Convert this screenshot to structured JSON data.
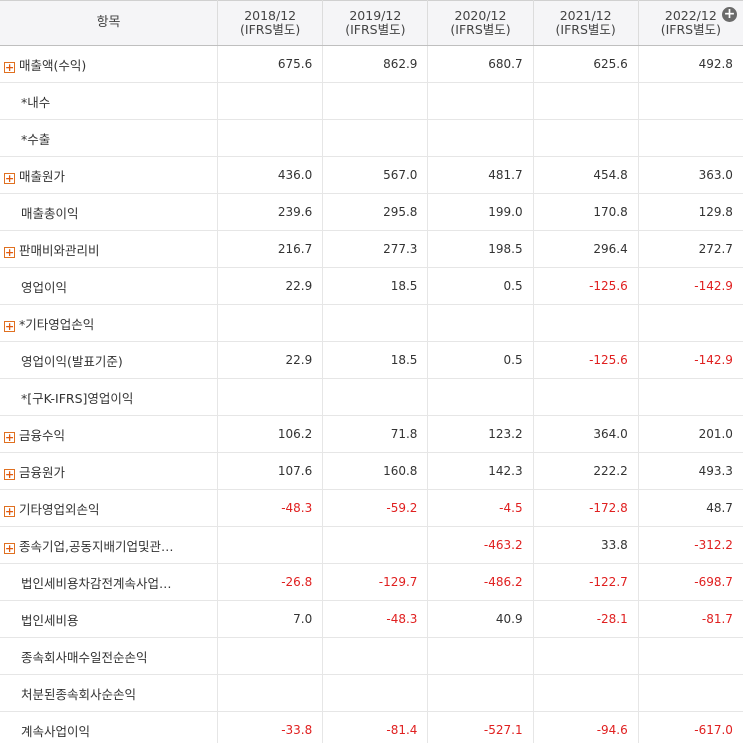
{
  "header": {
    "item_label": "항목",
    "years": [
      {
        "year": "2018/12",
        "basis": "(IFRS별도)"
      },
      {
        "year": "2019/12",
        "basis": "(IFRS별도)"
      },
      {
        "year": "2020/12",
        "basis": "(IFRS별도)"
      },
      {
        "year": "2021/12",
        "basis": "(IFRS별도)"
      },
      {
        "year": "2022/12",
        "basis": "(IFRS별도)"
      }
    ],
    "add_icon": "+"
  },
  "expand_icon": "+",
  "rows": [
    {
      "label": "매출액(수익)",
      "expandable": true,
      "values": [
        "675.6",
        "862.9",
        "680.7",
        "625.6",
        "492.8"
      ]
    },
    {
      "label": "*내수",
      "expandable": false,
      "values": [
        "",
        "",
        "",
        "",
        ""
      ]
    },
    {
      "label": "*수출",
      "expandable": false,
      "values": [
        "",
        "",
        "",
        "",
        ""
      ]
    },
    {
      "label": "매출원가",
      "expandable": true,
      "values": [
        "436.0",
        "567.0",
        "481.7",
        "454.8",
        "363.0"
      ]
    },
    {
      "label": "매출총이익",
      "expandable": false,
      "values": [
        "239.6",
        "295.8",
        "199.0",
        "170.8",
        "129.8"
      ]
    },
    {
      "label": "판매비와관리비",
      "expandable": true,
      "values": [
        "216.7",
        "277.3",
        "198.5",
        "296.4",
        "272.7"
      ]
    },
    {
      "label": "영업이익",
      "expandable": false,
      "values": [
        "22.9",
        "18.5",
        "0.5",
        "-125.6",
        "-142.9"
      ]
    },
    {
      "label": "*기타영업손익",
      "expandable": true,
      "values": [
        "",
        "",
        "",
        "",
        ""
      ]
    },
    {
      "label": "영업이익(발표기준)",
      "expandable": false,
      "values": [
        "22.9",
        "18.5",
        "0.5",
        "-125.6",
        "-142.9"
      ]
    },
    {
      "label": "*[구K-IFRS]영업이익",
      "expandable": false,
      "values": [
        "",
        "",
        "",
        "",
        ""
      ]
    },
    {
      "label": "금융수익",
      "expandable": true,
      "values": [
        "106.2",
        "71.8",
        "123.2",
        "364.0",
        "201.0"
      ]
    },
    {
      "label": "금융원가",
      "expandable": true,
      "values": [
        "107.6",
        "160.8",
        "142.3",
        "222.2",
        "493.3"
      ]
    },
    {
      "label": "기타영업외손익",
      "expandable": true,
      "values": [
        "-48.3",
        "-59.2",
        "-4.5",
        "-172.8",
        "48.7"
      ]
    },
    {
      "label": "종속기업,공동지배기업및관…",
      "expandable": true,
      "values": [
        "",
        "",
        "-463.2",
        "33.8",
        "-312.2"
      ]
    },
    {
      "label": "법인세비용차감전계속사업…",
      "expandable": false,
      "values": [
        "-26.8",
        "-129.7",
        "-486.2",
        "-122.7",
        "-698.7"
      ]
    },
    {
      "label": "법인세비용",
      "expandable": false,
      "values": [
        "7.0",
        "-48.3",
        "40.9",
        "-28.1",
        "-81.7"
      ]
    },
    {
      "label": "종속회사매수일전순손익",
      "expandable": false,
      "values": [
        "",
        "",
        "",
        "",
        ""
      ]
    },
    {
      "label": "처분된종속회사순손익",
      "expandable": false,
      "values": [
        "",
        "",
        "",
        "",
        ""
      ]
    },
    {
      "label": "계속사업이익",
      "expandable": false,
      "values": [
        "-33.8",
        "-81.4",
        "-527.1",
        "-94.6",
        "-617.0"
      ]
    }
  ],
  "colors": {
    "negative": "#e02020",
    "expand_icon": "#e05a10",
    "header_bg": "#f5f5f7"
  }
}
